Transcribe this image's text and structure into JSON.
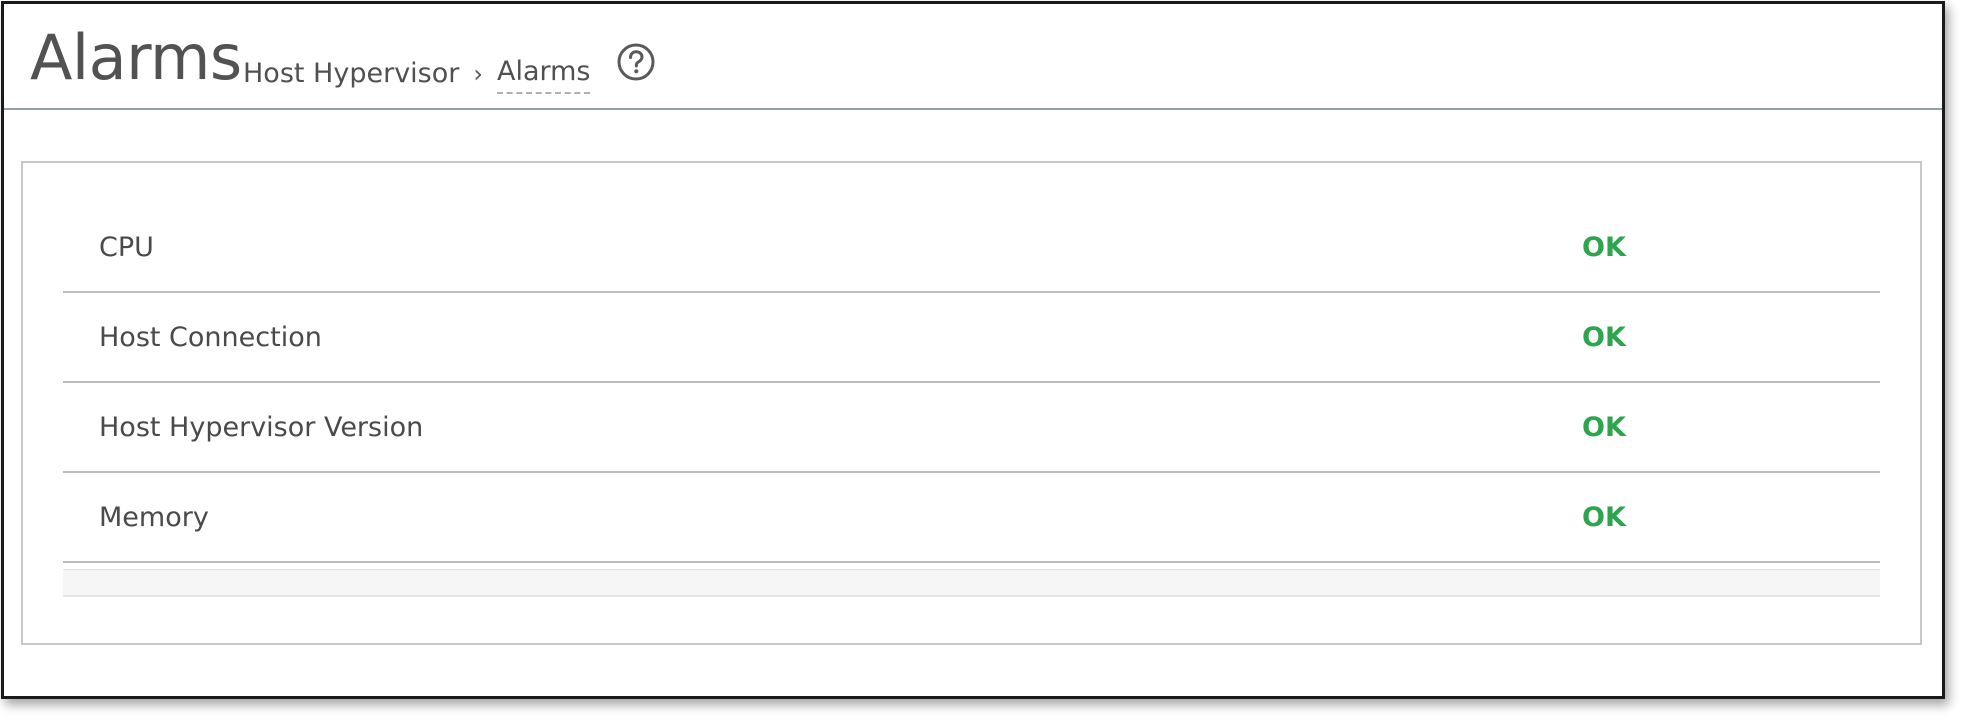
{
  "page": {
    "title": "Alarms"
  },
  "breadcrumb": {
    "parent": "Host Hypervisor",
    "separator": "›",
    "current": "Alarms"
  },
  "help": {
    "icon": "question-circle-icon"
  },
  "alarms": [
    {
      "name": "CPU",
      "status": "OK"
    },
    {
      "name": "Host Connection",
      "status": "OK"
    },
    {
      "name": "Host Hypervisor Version",
      "status": "OK"
    },
    {
      "name": "Memory",
      "status": "OK"
    }
  ],
  "colors": {
    "status_ok": "#2ea44f",
    "header_rule": "#8fa3a8",
    "panel_border": "#c8c8c8"
  }
}
